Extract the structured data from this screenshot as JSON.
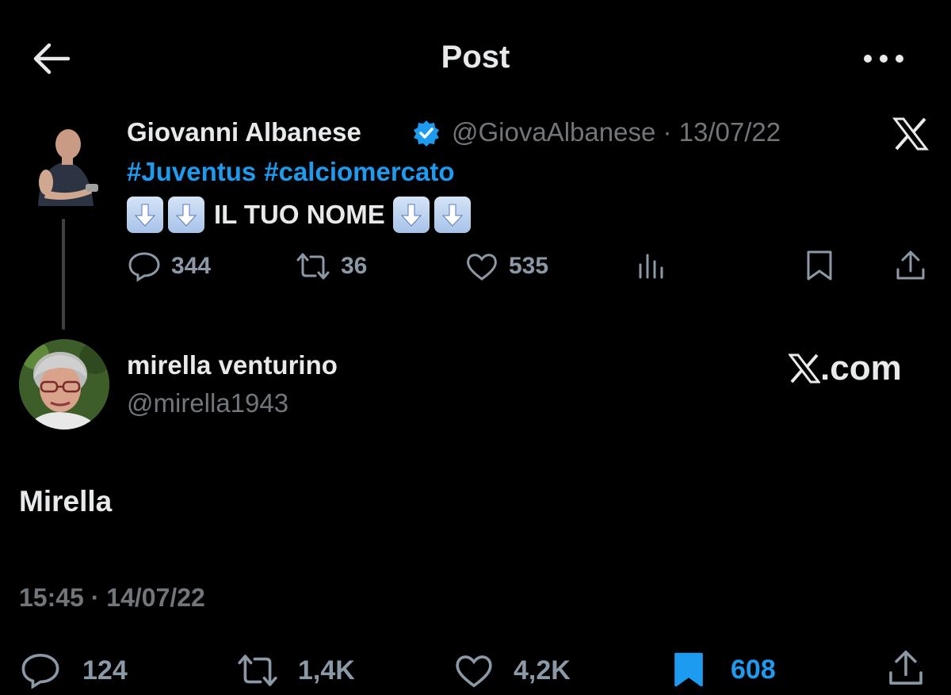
{
  "header": {
    "title": "Post",
    "back_icon": "arrow-left-icon",
    "more_icon": "more-horizontal-icon"
  },
  "quoted_post": {
    "author_name": "Giovanni Albanese",
    "verified_color": "#1d9bf0",
    "handle": "@GiovaAlbanese",
    "separator": "·",
    "date": "13/07/22",
    "hashtags": [
      "#Juventus",
      "#calciomercato"
    ],
    "text": "IL TUO NOME",
    "text_emoji": "down-arrow-emoji",
    "actions": {
      "replies": "344",
      "reposts": "36",
      "likes": "535"
    }
  },
  "reply_post": {
    "author_name": "mirella venturino",
    "handle": "@mirella1943",
    "watermark": ".com",
    "text": "Mirella",
    "timestamp": "15:45 · 14/07/22",
    "actions": {
      "replies": "124",
      "reposts": "1,4K",
      "likes": "4,2K",
      "bookmarks": "608"
    }
  },
  "colors": {
    "background": "#000000",
    "text": "#e7e9ea",
    "secondary": "#71767b",
    "accent": "#1d9bf0"
  }
}
